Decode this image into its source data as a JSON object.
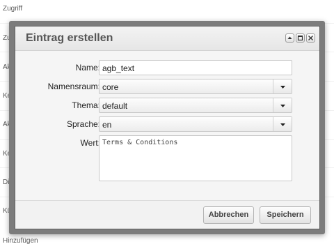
{
  "background": {
    "items": [
      "Zugriff",
      "Zug",
      "Akti",
      "Kein",
      "Akti",
      "Kein",
      "Dies",
      "Kür",
      "Hinzufügen"
    ]
  },
  "dialog": {
    "title": "Eintrag erstellen",
    "window_buttons": [
      "maximize-icon",
      "restore-icon",
      "close-icon"
    ],
    "fields": {
      "name": {
        "label": "Name:",
        "value": "agb_text"
      },
      "namespace": {
        "label": "Namensraum:",
        "value": "core"
      },
      "theme": {
        "label": "Thema:",
        "value": "default"
      },
      "language": {
        "label": "Sprache:",
        "value": "en"
      },
      "value": {
        "label": "Wert:",
        "value": "Terms & Conditions"
      }
    },
    "buttons": {
      "cancel": "Abbrechen",
      "save": "Speichern"
    }
  }
}
